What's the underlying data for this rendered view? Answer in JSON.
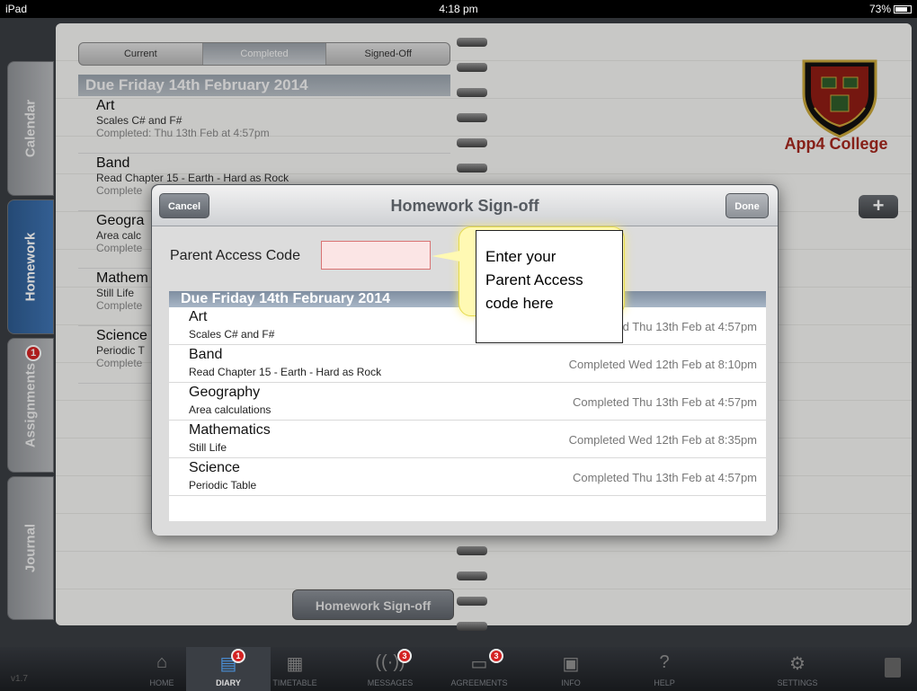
{
  "status_bar": {
    "device": "iPad",
    "time": "4:18 pm",
    "battery": "73%"
  },
  "side_tabs": [
    {
      "label": "Calendar"
    },
    {
      "label": "Homework"
    },
    {
      "label": "Assignments",
      "badge": "1"
    },
    {
      "label": "Journal"
    }
  ],
  "segments": [
    "Current",
    "Completed",
    "Signed-Off"
  ],
  "background_list": {
    "date_header": "Due Friday 14th February 2014",
    "items": [
      {
        "subject": "Art",
        "description": "Scales C# and F#",
        "status": "Completed: Thu 13th Feb at 4:57pm"
      },
      {
        "subject": "Band",
        "description": "Read Chapter 15 - Earth - Hard as Rock",
        "status": "Complete"
      },
      {
        "subject": "Geogra",
        "description": "Area calc",
        "status": "Complete"
      },
      {
        "subject": "Mathem",
        "description": "Still Life",
        "status": "Complete"
      },
      {
        "subject": "Science",
        "description": "Periodic T",
        "status": "Complete"
      }
    ]
  },
  "logo_text": "App4 College",
  "plus_button": "+",
  "page_signoff_button": "Homework Sign-off",
  "modal": {
    "title": "Homework Sign-off",
    "cancel": "Cancel",
    "done": "Done",
    "access_code_label": "Parent Access Code",
    "access_code_value": "",
    "date_header": "Due Friday 14th February 2014",
    "rows": [
      {
        "subject": "Art",
        "description": "Scales C# and F#",
        "status": "Completed Thu 13th Feb at 4:57pm"
      },
      {
        "subject": "Band",
        "description": "Read Chapter 15 - Earth - Hard as Rock",
        "status": "Completed Wed 12th Feb at 8:10pm"
      },
      {
        "subject": "Geography",
        "description": "Area calculations",
        "status": "Completed Thu 13th Feb at 4:57pm"
      },
      {
        "subject": "Mathematics",
        "description": "Still Life",
        "status": "Completed Wed 12th Feb at 8:35pm"
      },
      {
        "subject": "Science",
        "description": "Periodic Table",
        "status": "Completed Thu 13th Feb at 4:57pm"
      }
    ]
  },
  "callout": {
    "line1": "Enter your",
    "line2": "Parent Access",
    "line3": "code here"
  },
  "tabbar": {
    "version": "v1.7",
    "items": [
      {
        "label": "HOME",
        "icon": "home-icon"
      },
      {
        "label": "DIARY",
        "icon": "diary-icon",
        "badge": "1",
        "active": true
      },
      {
        "label": "TIMETABLE",
        "icon": "timetable-icon"
      },
      {
        "label": "MESSAGES",
        "icon": "messages-icon",
        "badge": "3"
      },
      {
        "label": "AGREEMENTS",
        "icon": "agreements-icon",
        "badge": "3"
      },
      {
        "label": "INFO",
        "icon": "info-icon"
      },
      {
        "label": "HELP",
        "icon": "help-icon"
      },
      {
        "label": "SETTINGS",
        "icon": "settings-icon"
      }
    ]
  },
  "colors": {
    "accent_blue": "#3f74b3",
    "badge_red": "#d42323",
    "logo_red": "#a4281e",
    "callout_yellow": "#fff9b3"
  }
}
